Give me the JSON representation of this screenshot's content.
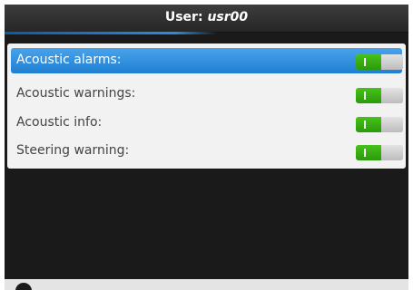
{
  "header": {
    "title_prefix": "User:",
    "title_user": "usr00"
  },
  "settings": [
    {
      "label": "Acoustic alarms:",
      "state": "on",
      "selected": true
    },
    {
      "label": "Acoustic warnings:",
      "state": "on",
      "selected": false
    },
    {
      "label": "Acoustic info:",
      "state": "on",
      "selected": false
    },
    {
      "label": "Steering warning:",
      "state": "on",
      "selected": false
    }
  ],
  "colors": {
    "accent": "#1f7fd3",
    "toggle_on": "#2b9a0b",
    "background": "#1a1a1a"
  }
}
